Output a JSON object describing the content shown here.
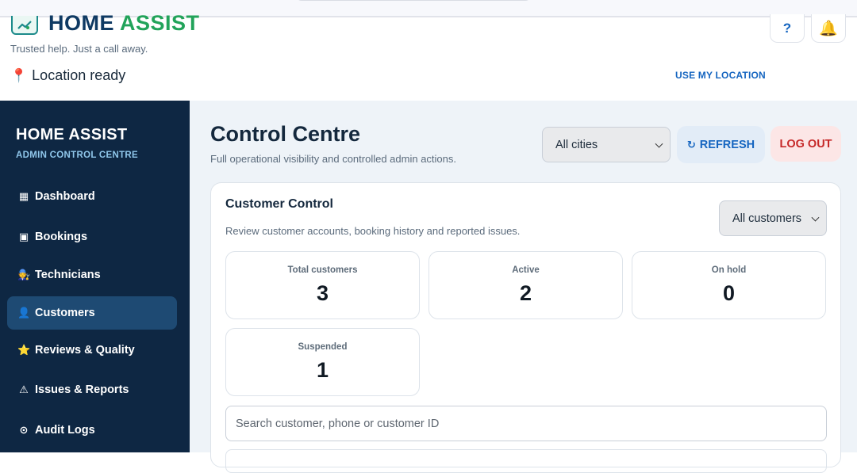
{
  "header": {
    "brand_part1": "HOME",
    "brand_part2": "ASSIST",
    "tagline": "Trusted help. Just a call away.",
    "location_icon": "map-pin-icon",
    "location_text": "Location ready",
    "use_location_label": "USE MY LOCATION",
    "help_label": "?",
    "bell_icon": "bell-icon"
  },
  "sidebar": {
    "title": "HOME ASSIST",
    "subtitle": "ADMIN CONTROL CENTRE",
    "items": [
      {
        "icon": "▦",
        "label": "Dashboard",
        "active": false
      },
      {
        "icon": "▣",
        "label": "Bookings",
        "active": false
      },
      {
        "icon": "🧑‍🔧",
        "label": "Technicians",
        "active": false
      },
      {
        "icon": "👤",
        "label": "Customers",
        "active": true
      },
      {
        "icon": "⭐",
        "label": "Reviews & Quality",
        "active": false
      },
      {
        "icon": "⚠",
        "label": "Issues & Reports",
        "active": false
      },
      {
        "icon": "⊙",
        "label": "Audit Logs",
        "active": false
      }
    ]
  },
  "main": {
    "title": "Control Centre",
    "subtitle": "Full operational visibility and controlled admin actions.",
    "city_select": "All cities",
    "refresh_icon": "↻",
    "refresh_label": "REFRESH",
    "logout_label": "LOG OUT",
    "card": {
      "title": "Customer Control",
      "subtitle": "Review customer accounts, booking history and reported issues.",
      "filter_select": "All customers",
      "stats": [
        {
          "label": "Total customers",
          "value": "3"
        },
        {
          "label": "Active",
          "value": "2"
        },
        {
          "label": "On hold",
          "value": "0"
        },
        {
          "label": "Suspended",
          "value": "1"
        }
      ],
      "search_placeholder": "Search customer, phone or customer ID"
    }
  },
  "colors": {
    "sidebar_bg": "#0e2743",
    "sidebar_active": "#1e4a73",
    "brand_blue": "#0f3a63",
    "brand_green": "#22a35a",
    "accent_blue": "#1565c0",
    "danger_red": "#c62828",
    "main_bg": "#eef3f8"
  }
}
